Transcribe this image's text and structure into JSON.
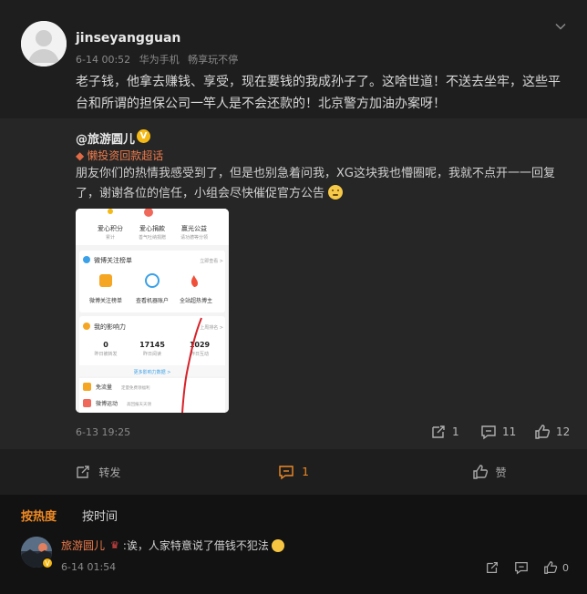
{
  "post": {
    "username": "jinseyangguan",
    "time": "6-14 00:52",
    "device": "华为手机",
    "device_extra": "畅享玩不停",
    "text": "老子钱，他拿去赚钱、享受，现在要钱的我成孙子了。这啥世道！不送去坐牢，这些平台和所谓的担保公司一竿人是不会还款的！北京警方加油办案呀！"
  },
  "repost": {
    "username": "@旅游圆儿",
    "verified_badge": "V",
    "tag": "懒投资回款超话",
    "text": "朋友你们的热情我感受到了，但是也别急着问我，XG这块我也懵圈呢，我就不点开一一回复了，谢谢各位的信任，小组会尽快催促官方公告",
    "time": "6-13 19:25",
    "reposts": "1",
    "comments": "11",
    "likes": "12",
    "screenshot": {
      "top_items": [
        "爱心积分",
        "爱心捐款",
        "赢光公益"
      ],
      "top_subs": [
        "累计",
        "善气吐纳捐赠",
        "请功德等分领"
      ],
      "section1_title": "微博关注榜单",
      "section1_link": "立即查看 >",
      "section1_items": [
        "微博关注榜单",
        "查看机器账户",
        "全站超热博主"
      ],
      "section2_title": "我的影响力",
      "section2_link": "上周排名 >",
      "stats": [
        {
          "value": "0",
          "label": "昨日被转发"
        },
        {
          "value": "17145",
          "label": "昨日阅读"
        },
        {
          "value": "1029",
          "label": "昨日互动"
        }
      ],
      "more": "更多影响力数据 >",
      "list_items": [
        {
          "label": "免流量",
          "sub": "定量免费领福利"
        },
        {
          "label": "微博运动",
          "sub": "高回报天天领"
        }
      ]
    }
  },
  "actions": {
    "forward": "转发",
    "comment": "1",
    "like": "赞"
  },
  "tabs": [
    "按热度",
    "按时间"
  ],
  "comment": {
    "username": "旅游圆儿",
    "text": ":诶，人家特意说了借钱不犯法",
    "time": "6-14 01:54",
    "likes": "0"
  },
  "colors": {
    "accent": "#f08a24",
    "tag": "#ec7a4b",
    "background": "#1e1e1e"
  },
  "icons": [
    "chevron-down-icon",
    "diamond-icon",
    "forward-icon",
    "comment-icon",
    "like-icon",
    "crown-icon"
  ]
}
